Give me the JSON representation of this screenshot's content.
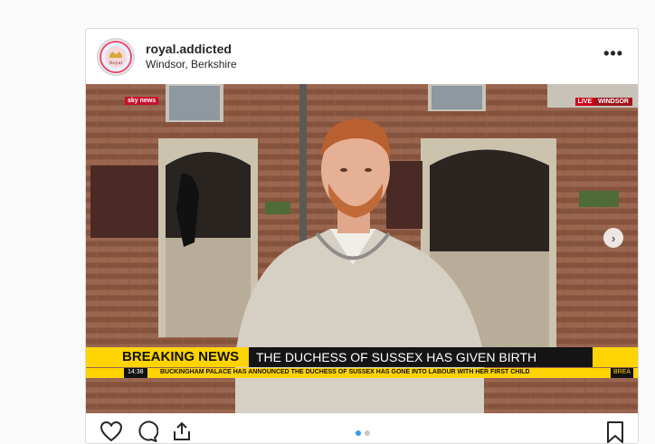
{
  "post": {
    "username": "royal.addicted",
    "location": "Windsor, Berkshire",
    "more_label": "•••"
  },
  "video": {
    "channel_logo": "sky news",
    "live_label": "LIVE",
    "live_location": "WINDSOR",
    "breaking_label": "BREAKING NEWS",
    "headline": "THE DUCHESS OF SUSSEX HAS GIVEN BIRTH",
    "time": "14:38",
    "crawl_text": "BUCKINGHAM PALACE HAS ANNOUNCED THE DUCHESS OF SUSSEX HAS GONE INTO LABOUR WITH HER FIRST CHILD",
    "crawl_end": "BREA"
  },
  "carousel": {
    "total_slides": 2,
    "active_slide": 1
  },
  "icons": {
    "like": "heart-icon",
    "comment": "comment-icon",
    "share": "share-icon",
    "save": "bookmark-icon",
    "next": "chevron-right-icon",
    "avatar": "avatar"
  },
  "colors": {
    "accent": "#3897f0",
    "ticker_yellow": "#ffd400",
    "live_red": "#d0021b"
  }
}
